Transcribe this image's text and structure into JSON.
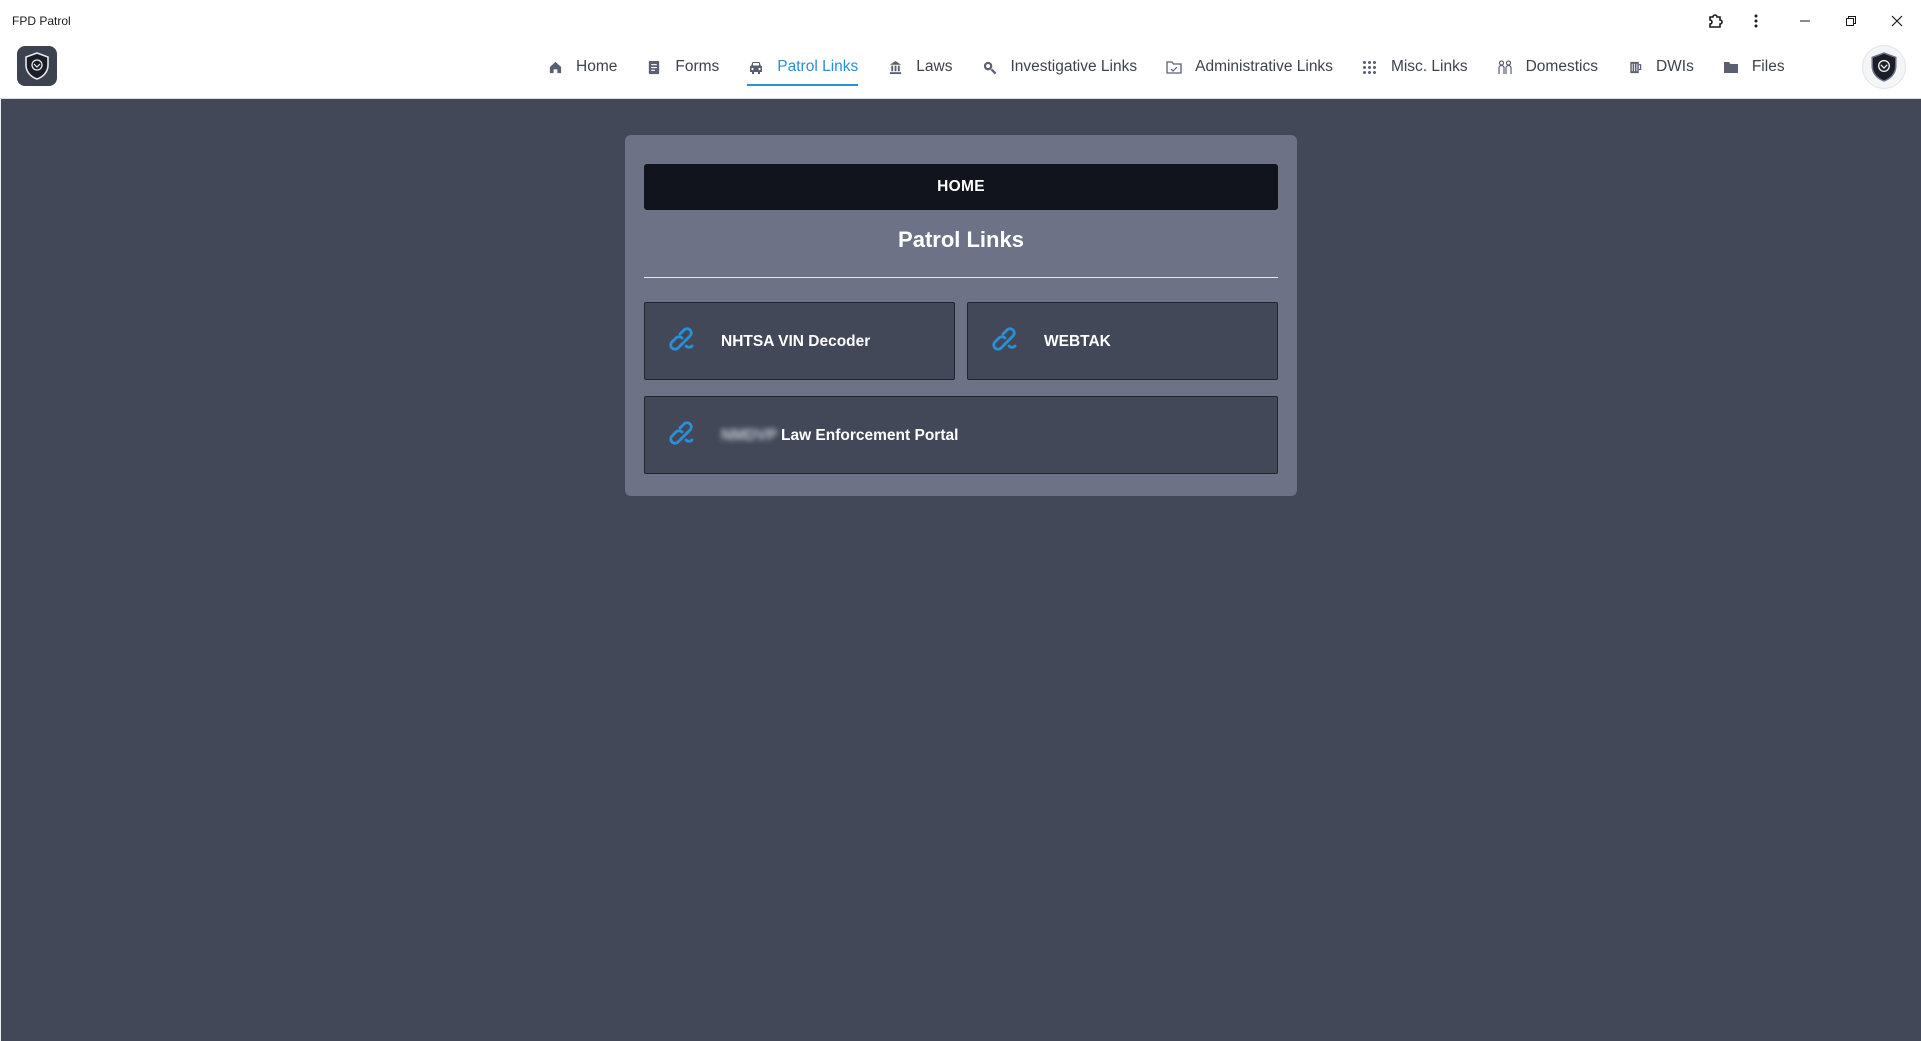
{
  "window": {
    "title": "FPD Patrol"
  },
  "nav": {
    "items": [
      {
        "label": "Home",
        "icon": "home-icon"
      },
      {
        "label": "Forms",
        "icon": "document-icon"
      },
      {
        "label": "Patrol Links",
        "icon": "car-icon",
        "active": true
      },
      {
        "label": "Laws",
        "icon": "courthouse-icon"
      },
      {
        "label": "Investigative Links",
        "icon": "magnifier-icon"
      },
      {
        "label": "Administrative Links",
        "icon": "folder-open-icon"
      },
      {
        "label": "Misc. Links",
        "icon": "grid-icon"
      },
      {
        "label": "Domestics",
        "icon": "people-icon"
      },
      {
        "label": "DWIs",
        "icon": "cup-icon"
      },
      {
        "label": "Files",
        "icon": "folder-icon"
      }
    ]
  },
  "panel": {
    "home_button": "HOME",
    "title": "Patrol Links",
    "links": [
      {
        "label": "NHTSA VIN Decoder",
        "icon": "link-icon"
      },
      {
        "label": "WEBTAK",
        "icon": "link-icon"
      },
      {
        "label_redacted": "NMDVP",
        "label": "Law Enforcement Portal",
        "icon": "link-icon"
      }
    ]
  },
  "colors": {
    "accent": "#2b8fd6",
    "background": "#424858",
    "panel": "#6d7286",
    "home_button": "#11131d"
  }
}
